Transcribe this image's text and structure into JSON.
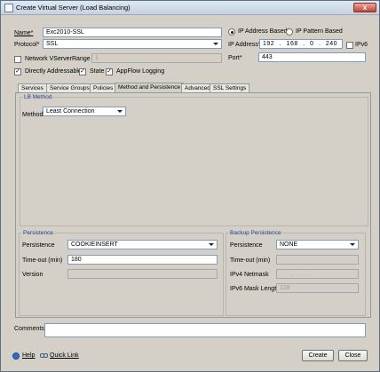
{
  "window": {
    "title": "Create Virtual Server (Load Balancing)",
    "close_glyph": "x"
  },
  "form": {
    "name_label": "Name*",
    "name_value": "Exc2010-SSL",
    "protocol_label": "Protocol*",
    "protocol_value": "SSL",
    "network_vserver_label": "Network VServer",
    "range_label": "Range",
    "range_value": "1",
    "directly_addressable_label": "Directly Addressable",
    "state_label": "State",
    "appflow_label": "AppFlow Logging",
    "ip_based_label": "IP Address Based",
    "ip_pattern_label": "IP Pattern Based",
    "ip_address_label": "IP Address*",
    "ip_octets": [
      "192",
      "168",
      "0",
      "240"
    ],
    "ip_dot": ".",
    "ipv6_label": "IPv6",
    "port_label": "Port*",
    "port_value": "443"
  },
  "tabs": [
    {
      "label": "Services"
    },
    {
      "label": "Service Groups"
    },
    {
      "label": "Policies"
    },
    {
      "label": "Method and Persistence"
    },
    {
      "label": "Advanced"
    },
    {
      "label": "SSL Settings"
    }
  ],
  "lb_method": {
    "legend": "LB Method",
    "method_label": "Method",
    "method_value": "Least Connection"
  },
  "persistence": {
    "legend": "Persistence",
    "persistence_label": "Persistence",
    "persistence_value": "COOKIEINSERT",
    "timeout_label": "Time-out (min)",
    "timeout_value": "180",
    "version_label": "Version",
    "version_value": ""
  },
  "backup_persistence": {
    "legend": "Backup Persistence",
    "persistence_label": "Persistence",
    "persistence_value": "NONE",
    "timeout_label": "Time-out (min)",
    "netmask_label": "IPv4 Netmask",
    "mask_length_label": "IPv6 Mask Length",
    "mask_length_value": "128"
  },
  "comments": {
    "label": "Comments",
    "value": ""
  },
  "footer": {
    "help_label": "Help",
    "quick_link_label": "Quick Link",
    "create_label": "Create",
    "close_label": "Close"
  },
  "checks": {
    "checked_glyph": "✓"
  }
}
